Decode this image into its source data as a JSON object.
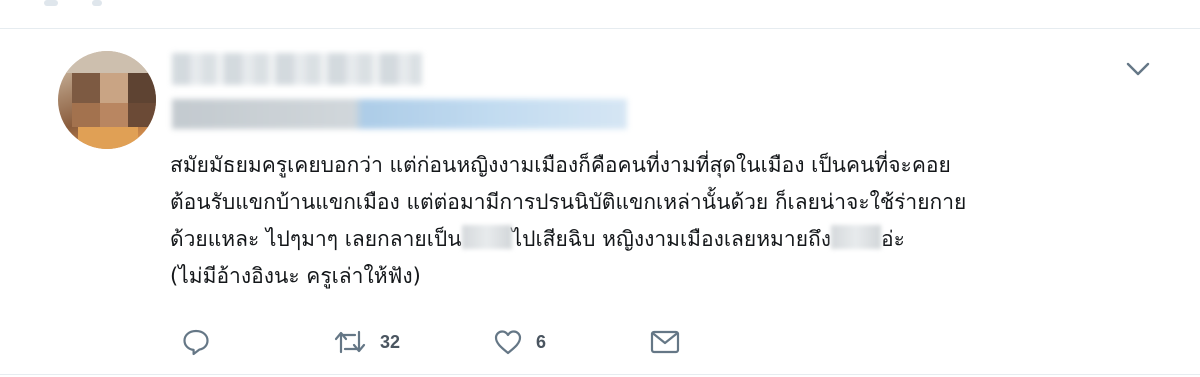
{
  "tweet": {
    "text_lines": [
      "สมัยมัธยมครูเคยบอกว่า แต่ก่อนหญิงงามเมืองก็คือคนที่งามที่สุดในเมือง เป็นคนที่จะคอย",
      "ต้อนรับแขกบ้านแขกเมือง แต่ต่อมามีการปรนนิบัติแขกเหล่านั้นด้วย ก็เลยน่าจะใช้ร่ายกาย",
      "(ไม่มีอ้างอิงนะ ครูเล่าให้ฟัง)"
    ],
    "line3": {
      "part1": "ด้วยแหละ ไปๆมาๆ เลยกลายเป็น",
      "part2": "ไปเสียฉิบ หญิงงามเมืองเลยหมายถึง",
      "part3": "อ่ะ"
    },
    "actions": {
      "retweet_count": "32",
      "like_count": "6"
    }
  },
  "icons": {
    "caret": "chevron-down-icon",
    "reply": "reply-icon",
    "retweet": "retweet-icon",
    "like": "heart-icon",
    "dm": "envelope-icon"
  },
  "colors": {
    "icon": "#657786",
    "text": "#14171a",
    "divider": "#e6ecf0"
  }
}
